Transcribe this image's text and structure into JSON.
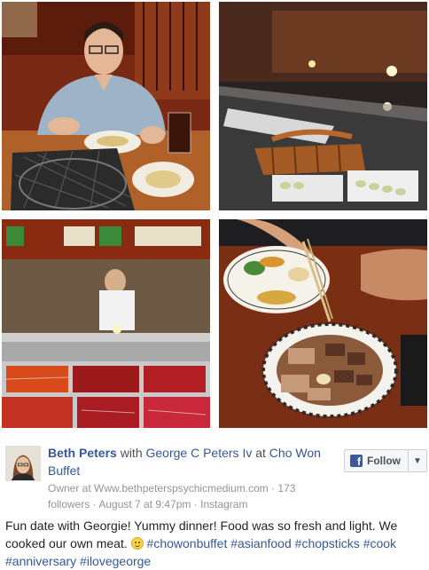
{
  "photos": [
    {
      "name": "photo-man-at-grill-table"
    },
    {
      "name": "photo-sushi-buffet-counter"
    },
    {
      "name": "photo-raw-meat-buffet"
    },
    {
      "name": "photo-plates-with-chopsticks"
    }
  ],
  "post": {
    "author": "Beth Peters",
    "with_text": " with ",
    "tagged": "George C Peters Iv",
    "at_text": " at ",
    "place": "Cho Won Buffet",
    "owner_prefix": "Owner at ",
    "owner_site": "Www.bethpeterspsychicmedium.com",
    "followers": " · 173 followers · ",
    "date": "August 7 at 9:47pm",
    "sep": " · ",
    "source": "Instagram",
    "follow_label": "Follow",
    "body_text": "Fun date with Georgie! Yummy dinner! Food was so fresh and light. We cooked our own meat. ",
    "hashtags": [
      "#chowonbuffet",
      "#asianfood",
      "#chopsticks",
      "#cook",
      "#anniversary",
      "#ilovegeorge"
    ]
  },
  "colors": {
    "link": "#365899",
    "facebook_blue": "#3b5998",
    "meta_grey": "#90949c"
  },
  "icons": {
    "follow": "facebook-icon",
    "dropdown": "chevron-down-icon",
    "emoji": "smiley-emoji-icon"
  }
}
